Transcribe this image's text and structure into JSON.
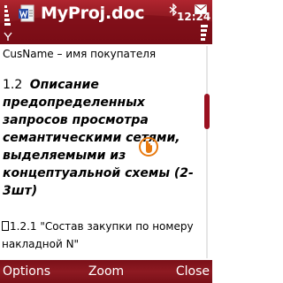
{
  "status": {
    "app_title": "MyProj.doc",
    "time": "12:24"
  },
  "document": {
    "line1": "CusName – имя покупателя",
    "heading_number": "1.2",
    "heading_text": "Описание предопределенных запросов просмотра семантическими сетями, выделяемыми из концептуальной схемы (2-3шт)",
    "item_text": "1.2.1 \"Состав закупки по номеру накладной N\""
  },
  "softkeys": {
    "left": "Options",
    "middle": "Zoom",
    "right": "Close"
  },
  "colors": {
    "accent": "#8c1820",
    "cursor": "#e87a10"
  },
  "icons": {
    "signal": "signal-strength-icon",
    "app": "word-document-icon",
    "bluetooth": "bluetooth-icon",
    "mail": "envelope-icon",
    "battery": "battery-level-icon",
    "cursor": "touch-cursor-icon"
  }
}
